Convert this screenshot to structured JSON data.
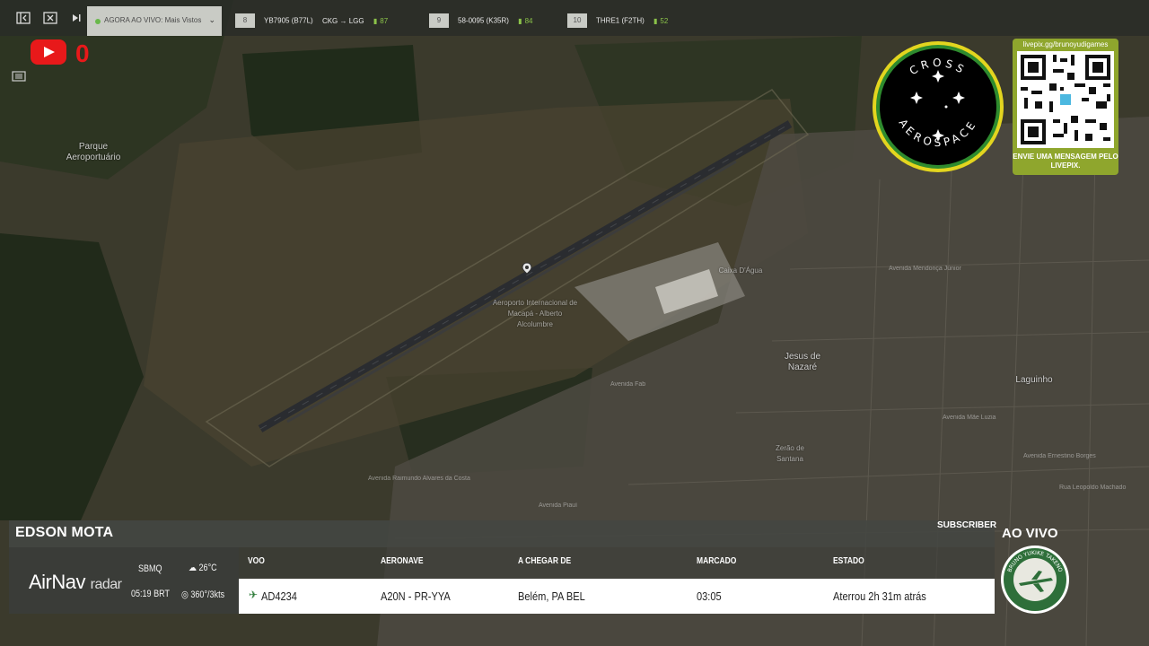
{
  "colors": {
    "youtube_red": "#e8191a",
    "badge_ring": "#e3d51f",
    "badge_green": "#2e8b2e",
    "qr_green": "#8fa62d",
    "signal_green": "#8bc34a"
  },
  "top_bar": {
    "icons": [
      "sidebar-toggle-icon",
      "close-box-icon",
      "skip-forward-icon"
    ],
    "live_tab": {
      "label": "AGORA AO VIVO: Mais Vistos",
      "icon": "chevron-down-icon"
    },
    "flights": [
      {
        "num": "8",
        "callsign": "YB7905 (B77L)",
        "route": "CKG → LGG",
        "signal": "87"
      },
      {
        "num": "9",
        "callsign": "58-0095 (K35R)",
        "route": "",
        "signal": "84"
      },
      {
        "num": "10",
        "callsign": "THRE1 (F2TH)",
        "route": "",
        "signal": "52"
      }
    ]
  },
  "overlay": {
    "youtube_icon": "youtube-play-icon",
    "youtube_count": "0",
    "side_icon": "list-icon"
  },
  "map_labels": {
    "park": "Parque Aeroportuário",
    "airport": "Aeroporto Internacional de Macapá - Alberto Alcolumbre",
    "caixa": "Caixa D'Água",
    "jesus": "Jesus de Nazaré",
    "laguinho": "Laguinho",
    "zerao": "Zerão de Santana",
    "streets": [
      "Avenida Mendonça Júnior",
      "Avenida Fab",
      "Avenida Raimundo Alvares da Costa",
      "Avenida Ernestino Borges",
      "Avenida Mãe Luzia",
      "Rua Leopoldo Machado",
      "Avenida Piauí"
    ]
  },
  "badge": {
    "top": "CROSS",
    "bottom": "AEROSPACE"
  },
  "qr": {
    "url": "livepix.gg/brunoyudigames",
    "message": "ENVIE UMA MENSAGEM PELO LIVEPIX."
  },
  "bottom": {
    "name": "EDSON MOTA",
    "subscriber": "SUBSCRIBER",
    "brand": {
      "main": "AirNav",
      "sub": "radar"
    },
    "weather": {
      "airport": "SBMQ",
      "time": "05:19 BRT",
      "temp": "26°C",
      "wind": "360°/3kts"
    },
    "headers": {
      "voo": "VOO",
      "aeronave": "AERONAVE",
      "origem": "A CHEGAR DE",
      "marcado": "MARCADO",
      "estado": "ESTADO"
    },
    "flight": {
      "voo": "AD4234",
      "aeronave": "A20N - PR-YYA",
      "origem": "Belém, PA BEL",
      "marcado": "03:05",
      "estado": "Aterrou 2h 31m atrás"
    }
  },
  "live_label": "AO VIVO",
  "channel_logo_text": "BRUNO YUKIKE TAKENO"
}
